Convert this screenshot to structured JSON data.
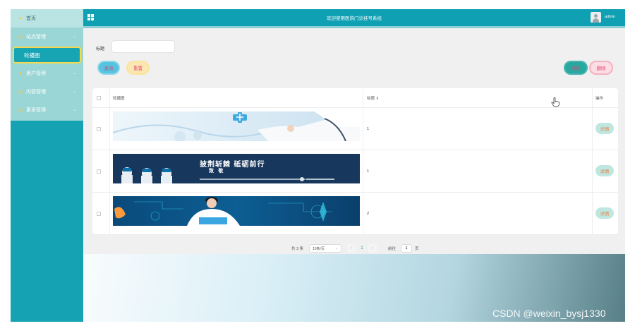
{
  "header": {
    "title": "欢迎使用医院门诊挂号系统",
    "username": "admin"
  },
  "sidebar": {
    "items": [
      {
        "label": "首页",
        "icon": "home-icon"
      },
      {
        "label": "站点管理",
        "icon": "site-icon"
      },
      {
        "label": "轮播图",
        "icon": "",
        "active": true
      },
      {
        "label": "用户管理",
        "icon": "user-icon"
      },
      {
        "label": "内容管理",
        "icon": "content-icon"
      },
      {
        "label": "更多管理",
        "icon": "more-icon"
      }
    ]
  },
  "search": {
    "label": "标题",
    "value": "",
    "placeholder": ""
  },
  "buttons": {
    "query": "查询",
    "reset": "重置",
    "add": "添加",
    "delete": "删除"
  },
  "table": {
    "columns": [
      "轮播图",
      "标题 ⇕",
      "操作"
    ],
    "rows": [
      {
        "title": "1",
        "action": "详情"
      },
      {
        "title": "1",
        "action": "详情",
        "banner_text": [
          "披荆斩棘 砥砺前行",
          "致 敬"
        ]
      },
      {
        "title": "2",
        "action": "详情"
      }
    ]
  },
  "pagination": {
    "total": "共 3 条",
    "page_size": "10条/页",
    "prev": "‹",
    "current": "1",
    "next": "›",
    "goto_label": "前往",
    "goto_value": "1",
    "page_unit": "页"
  },
  "watermark": "CSDN @weixin_bysj1330",
  "colors": {
    "sidebar": "#15a3b3",
    "header": "#0fa0b3",
    "accent_text": "#e0457b",
    "detail_button": "#bfe7e2"
  }
}
